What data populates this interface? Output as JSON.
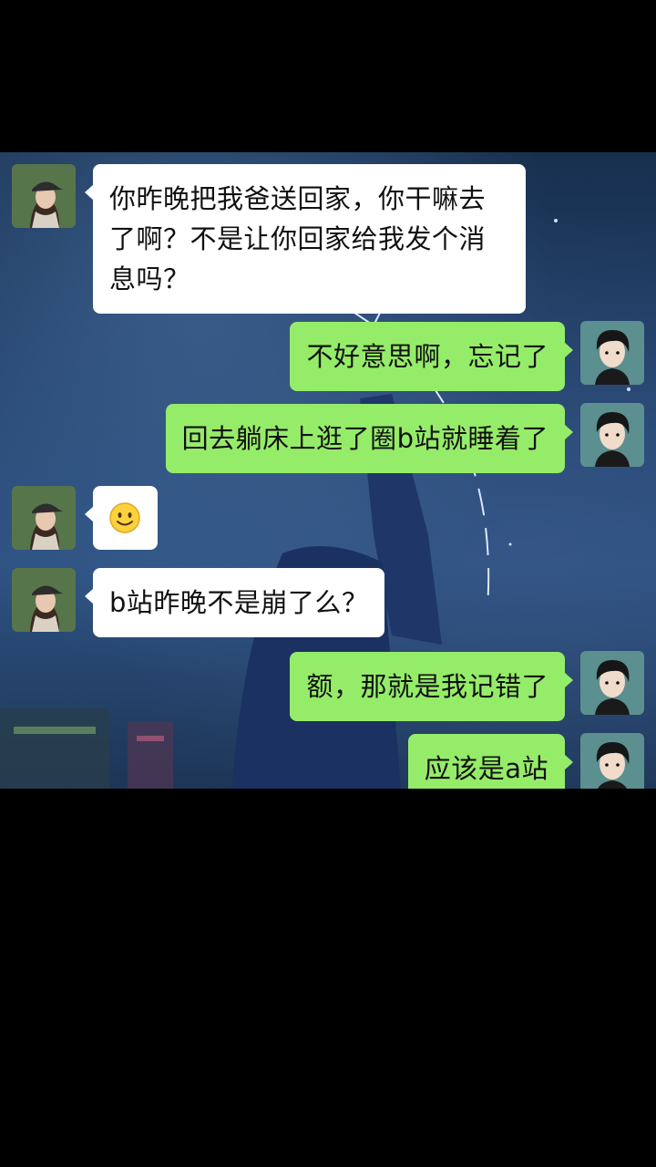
{
  "colors": {
    "outgoing_bubble": "#95ec69",
    "incoming_bubble": "#ffffff",
    "frame": "#000000"
  },
  "contact": {
    "avatar_icon": "girl-with-cap-avatar"
  },
  "me": {
    "avatar_icon": "anime-boy-avatar"
  },
  "messages": [
    {
      "sender": "contact",
      "type": "text",
      "text": "你昨晚把我爸送回家，你干嘛去了啊？不是让你回家给我发个消息吗？"
    },
    {
      "sender": "me",
      "type": "text",
      "text": "不好意思啊，忘记了"
    },
    {
      "sender": "me",
      "type": "text",
      "text": "回去躺床上逛了圈b站就睡着了"
    },
    {
      "sender": "contact",
      "type": "emoji",
      "emoji": "smile-emoji"
    },
    {
      "sender": "contact",
      "type": "text",
      "text": "b站昨晚不是崩了么？"
    },
    {
      "sender": "me",
      "type": "text",
      "text": "额，那就是我记错了"
    },
    {
      "sender": "me",
      "type": "text",
      "text": "应该是a站"
    }
  ]
}
